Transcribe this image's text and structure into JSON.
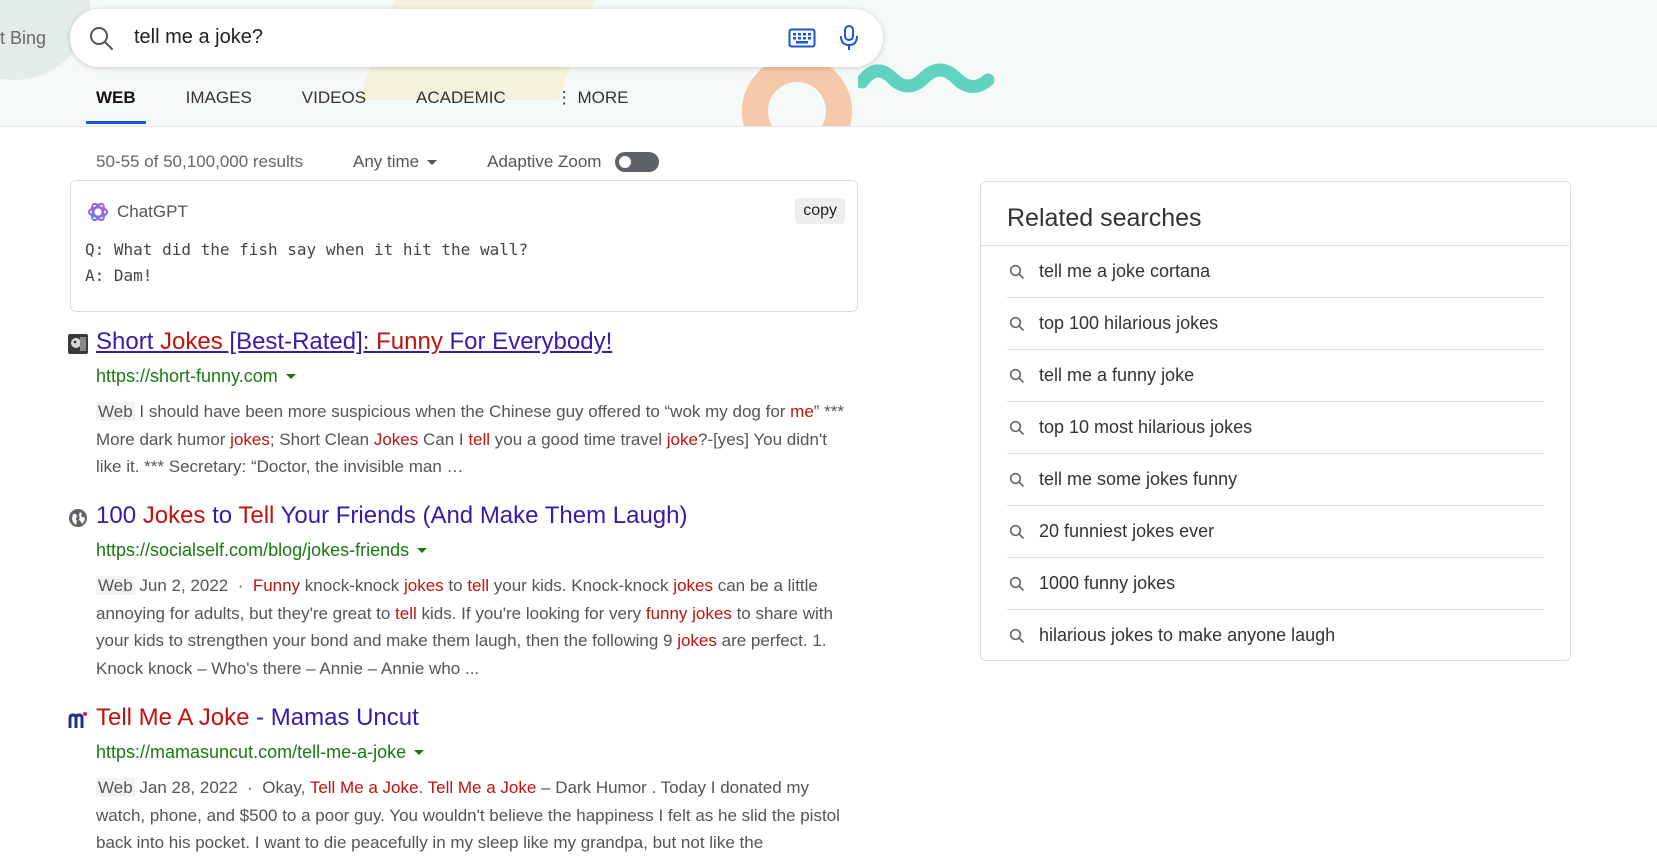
{
  "header": {
    "brand_fragment": "t Bing",
    "search_query": "tell me a joke?",
    "tabs": [
      {
        "label": "WEB",
        "active": true
      },
      {
        "label": "IMAGES",
        "active": false
      },
      {
        "label": "VIDEOS",
        "active": false
      },
      {
        "label": "ACADEMIC",
        "active": false
      },
      {
        "label": "⋮ MORE",
        "active": false
      }
    ]
  },
  "meta": {
    "results_count": "50-55 of 50,100,000 results",
    "time_filter": "Any time",
    "adaptive_zoom_label": "Adaptive Zoom",
    "adaptive_zoom_on": false
  },
  "chatgpt": {
    "label": "ChatGPT",
    "copy_label": "copy",
    "line1": "Q: What did the fish say when it hit the wall?",
    "line2": "A: Dam!"
  },
  "results": [
    {
      "title": "Short Jokes [Best-Rated]: Funny For Everybody!",
      "url": "https://short-funny.com",
      "web_tag": "Web",
      "snippet": "I should have been more suspicious when the Chinese guy offered to “wok my dog for me” *** More dark humor jokes; Short Clean Jokes Can I tell you a good time travel joke?-[yes] You didn't like it. *** Secretary: “Doctor, the invisible man …"
    },
    {
      "title": "100 Jokes to Tell Your Friends (And Make Them Laugh)",
      "url": "https://socialself.com/blog/jokes-friends",
      "web_tag": "Web",
      "date": "Jun 2, 2022",
      "snippet": "Funny knock-knock jokes to tell your kids. Knock-knock jokes can be a little annoying for adults, but they're great to tell kids. If you're looking for very funny jokes to share with your kids to strengthen your bond and make them laugh, then the following 9 jokes are perfect. 1. Knock knock – Who's there – Annie – Annie who ..."
    },
    {
      "title": "Tell Me A Joke - Mamas Uncut",
      "url": "https://mamasuncut.com/tell-me-a-joke",
      "web_tag": "Web",
      "date": "Jan 28, 2022",
      "snippet": "Okay, Tell Me a Joke. Tell Me a Joke – Dark Humor . Today I donated my watch, phone, and $500 to a poor guy. You wouldn't believe the happiness I felt as he slid the pistol back into his pocket. I want to die peacefully in my sleep like my grandpa, but not like the"
    }
  ],
  "related": {
    "title": "Related searches",
    "items": [
      "tell me a joke cortana",
      "top 100 hilarious jokes",
      "tell me a funny joke",
      "top 10 most hilarious jokes",
      "tell me some jokes funny",
      "20 funniest jokes ever",
      "1000 funny jokes",
      "hilarious jokes to make anyone laugh"
    ]
  },
  "colors": {
    "title_link": "#3a1aa8",
    "highlight": "#c0120e",
    "url_green": "#177a10",
    "tab_underline": "#1a56d6"
  }
}
